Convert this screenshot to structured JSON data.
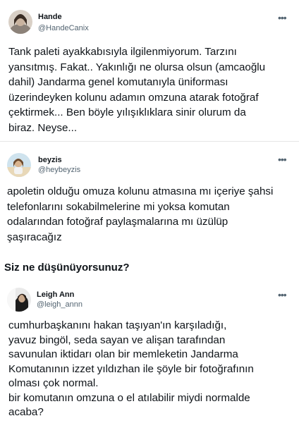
{
  "tweets": [
    {
      "name": "Hande",
      "handle": "@HandeCanix",
      "more_icon": "more-horizontal-icon",
      "lines": [
        "Tank paleti ayakkabısıyla ilgilenmiyorum. Tarzını",
        "yansıtmış. Fakat.. Yakınlığı ne olursa olsun (amcaoğlu",
        "dahil) Jandarma genel komutanıyla üniforması",
        "üzerindeyken kolunu adamın omzuna atarak fotoğraf",
        "çektirmek... Ben böyle yılışıklıklara sinir olurum da",
        "biraz. Neyse..."
      ]
    },
    {
      "name": "beyzis",
      "handle": "@heybeyzis",
      "more_icon": "more-horizontal-icon",
      "lines": [
        "apoletin olduğu omuza kolunu atmasına mı içeriye şahsi",
        "telefonlarını sokabilmelerine mi yoksa komutan",
        "odalarından fotoğraf paylaşmalarına mı üzülüp",
        "şaşıracağız"
      ]
    },
    {
      "name": "Leigh Ann",
      "handle": "@leigh_annn",
      "more_icon": "more-horizontal-icon",
      "lines": [
        "cumhurbaşkanını hakan taşıyan'ın karşıladığı,",
        "yavuz bingöl, seda sayan ve alişan tarafından",
        "savunulan iktidarı olan bir memleketin Jandarma",
        "Komutanının izzet yıldızhan ile şöyle bir fotoğrafının",
        "olması çok normal.",
        "bir komutanın omzuna o el atılabilir miydi normalde",
        "acaba?"
      ]
    }
  ],
  "question": "Siz ne düşünüyorsunuz?",
  "more_glyph": "•••"
}
